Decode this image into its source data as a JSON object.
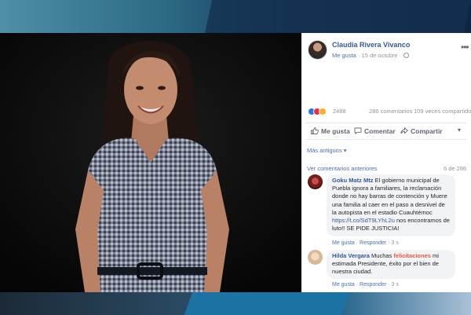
{
  "post": {
    "author": "Claudia Rivera Vivanco",
    "like_page_label": "Me gusta",
    "date": "15 de octubre",
    "more_label": "•••"
  },
  "stats": {
    "reaction_count": "2488",
    "comments_count": "286 comentarios",
    "shares_count": "109 veces compartido"
  },
  "actions": {
    "like": "Me gusta",
    "comment": "Comentar",
    "share": "Compartir",
    "caret": "▾"
  },
  "comments_section": {
    "sort_label": "Más antiguos ▾",
    "view_previous": "Ver comentarios anteriores",
    "page_count": "6 de 286"
  },
  "comments": [
    {
      "name": "Goku Matz Mtz",
      "text_before_link": "El gobierno municipal de Puebla ignora a familiares, la reclamación donde no hay barras de contención y Muere una familia al caer en el paso a desnivel de la autopista en el estadio Cuauhtémoc",
      "link": "https://t.co/SdT9LYhL2u",
      "text_after_link": "nos encontramos de luto!! SE PIDE JUSTICIA!",
      "like_label": "Me gusta",
      "reply_label": "Responder",
      "time": "3 s"
    },
    {
      "name": "Hilda Vergara",
      "text_before": "Muchas",
      "highlight": "felicitaciones",
      "text_after": "mi estimada Presidente, éxito por el bien de nuestra ciudad.",
      "like_label": "Me gusta",
      "reply_label": "Responder",
      "time": "3 s"
    }
  ],
  "colors": {
    "link_blue": "#365899",
    "muted_gray": "#90949c",
    "bubble_bg": "#f2f3f5",
    "highlight_red": "#e9573f",
    "photo_bg": "#0a0a0a"
  }
}
